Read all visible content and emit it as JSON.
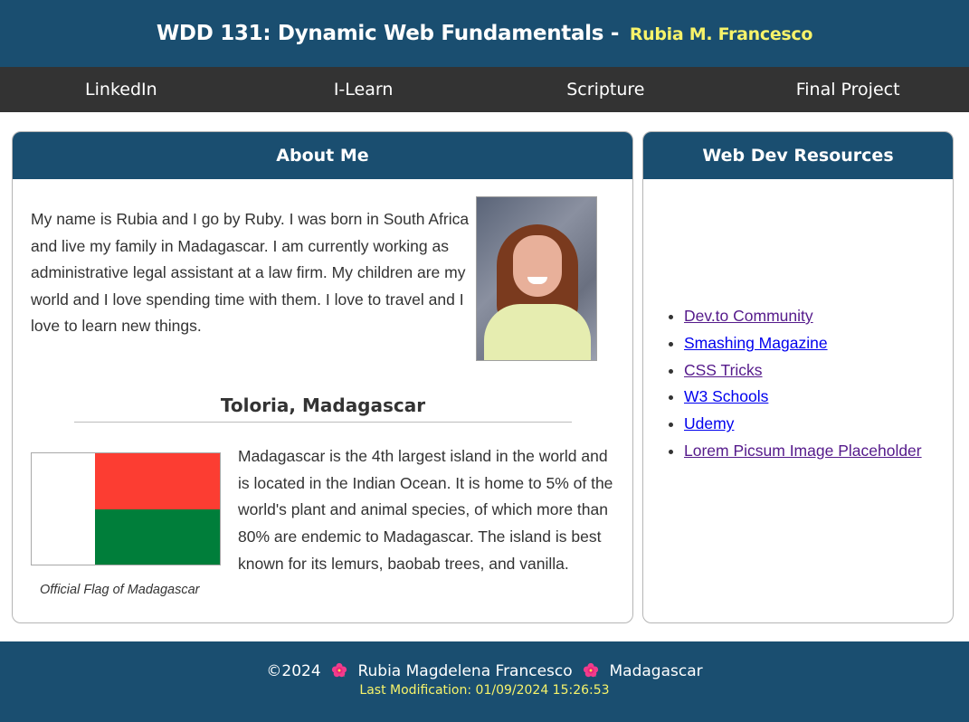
{
  "header": {
    "title": "WDD 131: Dynamic Web Fundamentals -",
    "author_name": "Rubia M. Francesco"
  },
  "nav": {
    "items": [
      {
        "label": "LinkedIn"
      },
      {
        "label": "I-Learn"
      },
      {
        "label": "Scripture"
      },
      {
        "label": "Final Project"
      }
    ]
  },
  "about": {
    "heading": "About Me",
    "bio": "My name is Rubia and I go by Ruby. I was born in South Africa and live my family in Madagascar. I am currently working as administrative legal assistant at a law firm. My children are my world and I love spending time with them. I love to travel and I love to learn new things.",
    "portrait_alt": "Portrait of Rubia",
    "city_heading": "Toloria, Madagascar",
    "flag_caption": "Official Flag of Madagascar",
    "flag_colors": {
      "white": "#ffffff",
      "red": "#fc3d32",
      "green": "#007e3a"
    },
    "madagascar_text": "Madagascar is the 4th largest island in the world and is located in the Indian Ocean. It is home to 5% of the world's plant and animal species, of which more than 80% are endemic to Madagascar. The island is best known for its lemurs, baobab trees, and vanilla."
  },
  "resources": {
    "heading": "Web Dev Resources",
    "links": [
      {
        "label": "Dev.to Community",
        "visited": true
      },
      {
        "label": "Smashing Magazine",
        "visited": false
      },
      {
        "label": "CSS Tricks",
        "visited": true
      },
      {
        "label": "W3 Schools",
        "visited": false
      },
      {
        "label": "Udemy",
        "visited": false
      },
      {
        "label": "Lorem Picsum Image Placeholder",
        "visited": true
      }
    ]
  },
  "footer": {
    "copyright": "©2024",
    "separator_icon": "hibiscus-icon",
    "author_full_name": "Rubia Magdelena Francesco",
    "country": "Madagascar",
    "last_modification": "Last Modification: 01/09/2024 15:26:53"
  },
  "colors": {
    "primary": "#1a4e70",
    "nav_bg": "#333333",
    "accent_yellow": "#f7f36a"
  }
}
